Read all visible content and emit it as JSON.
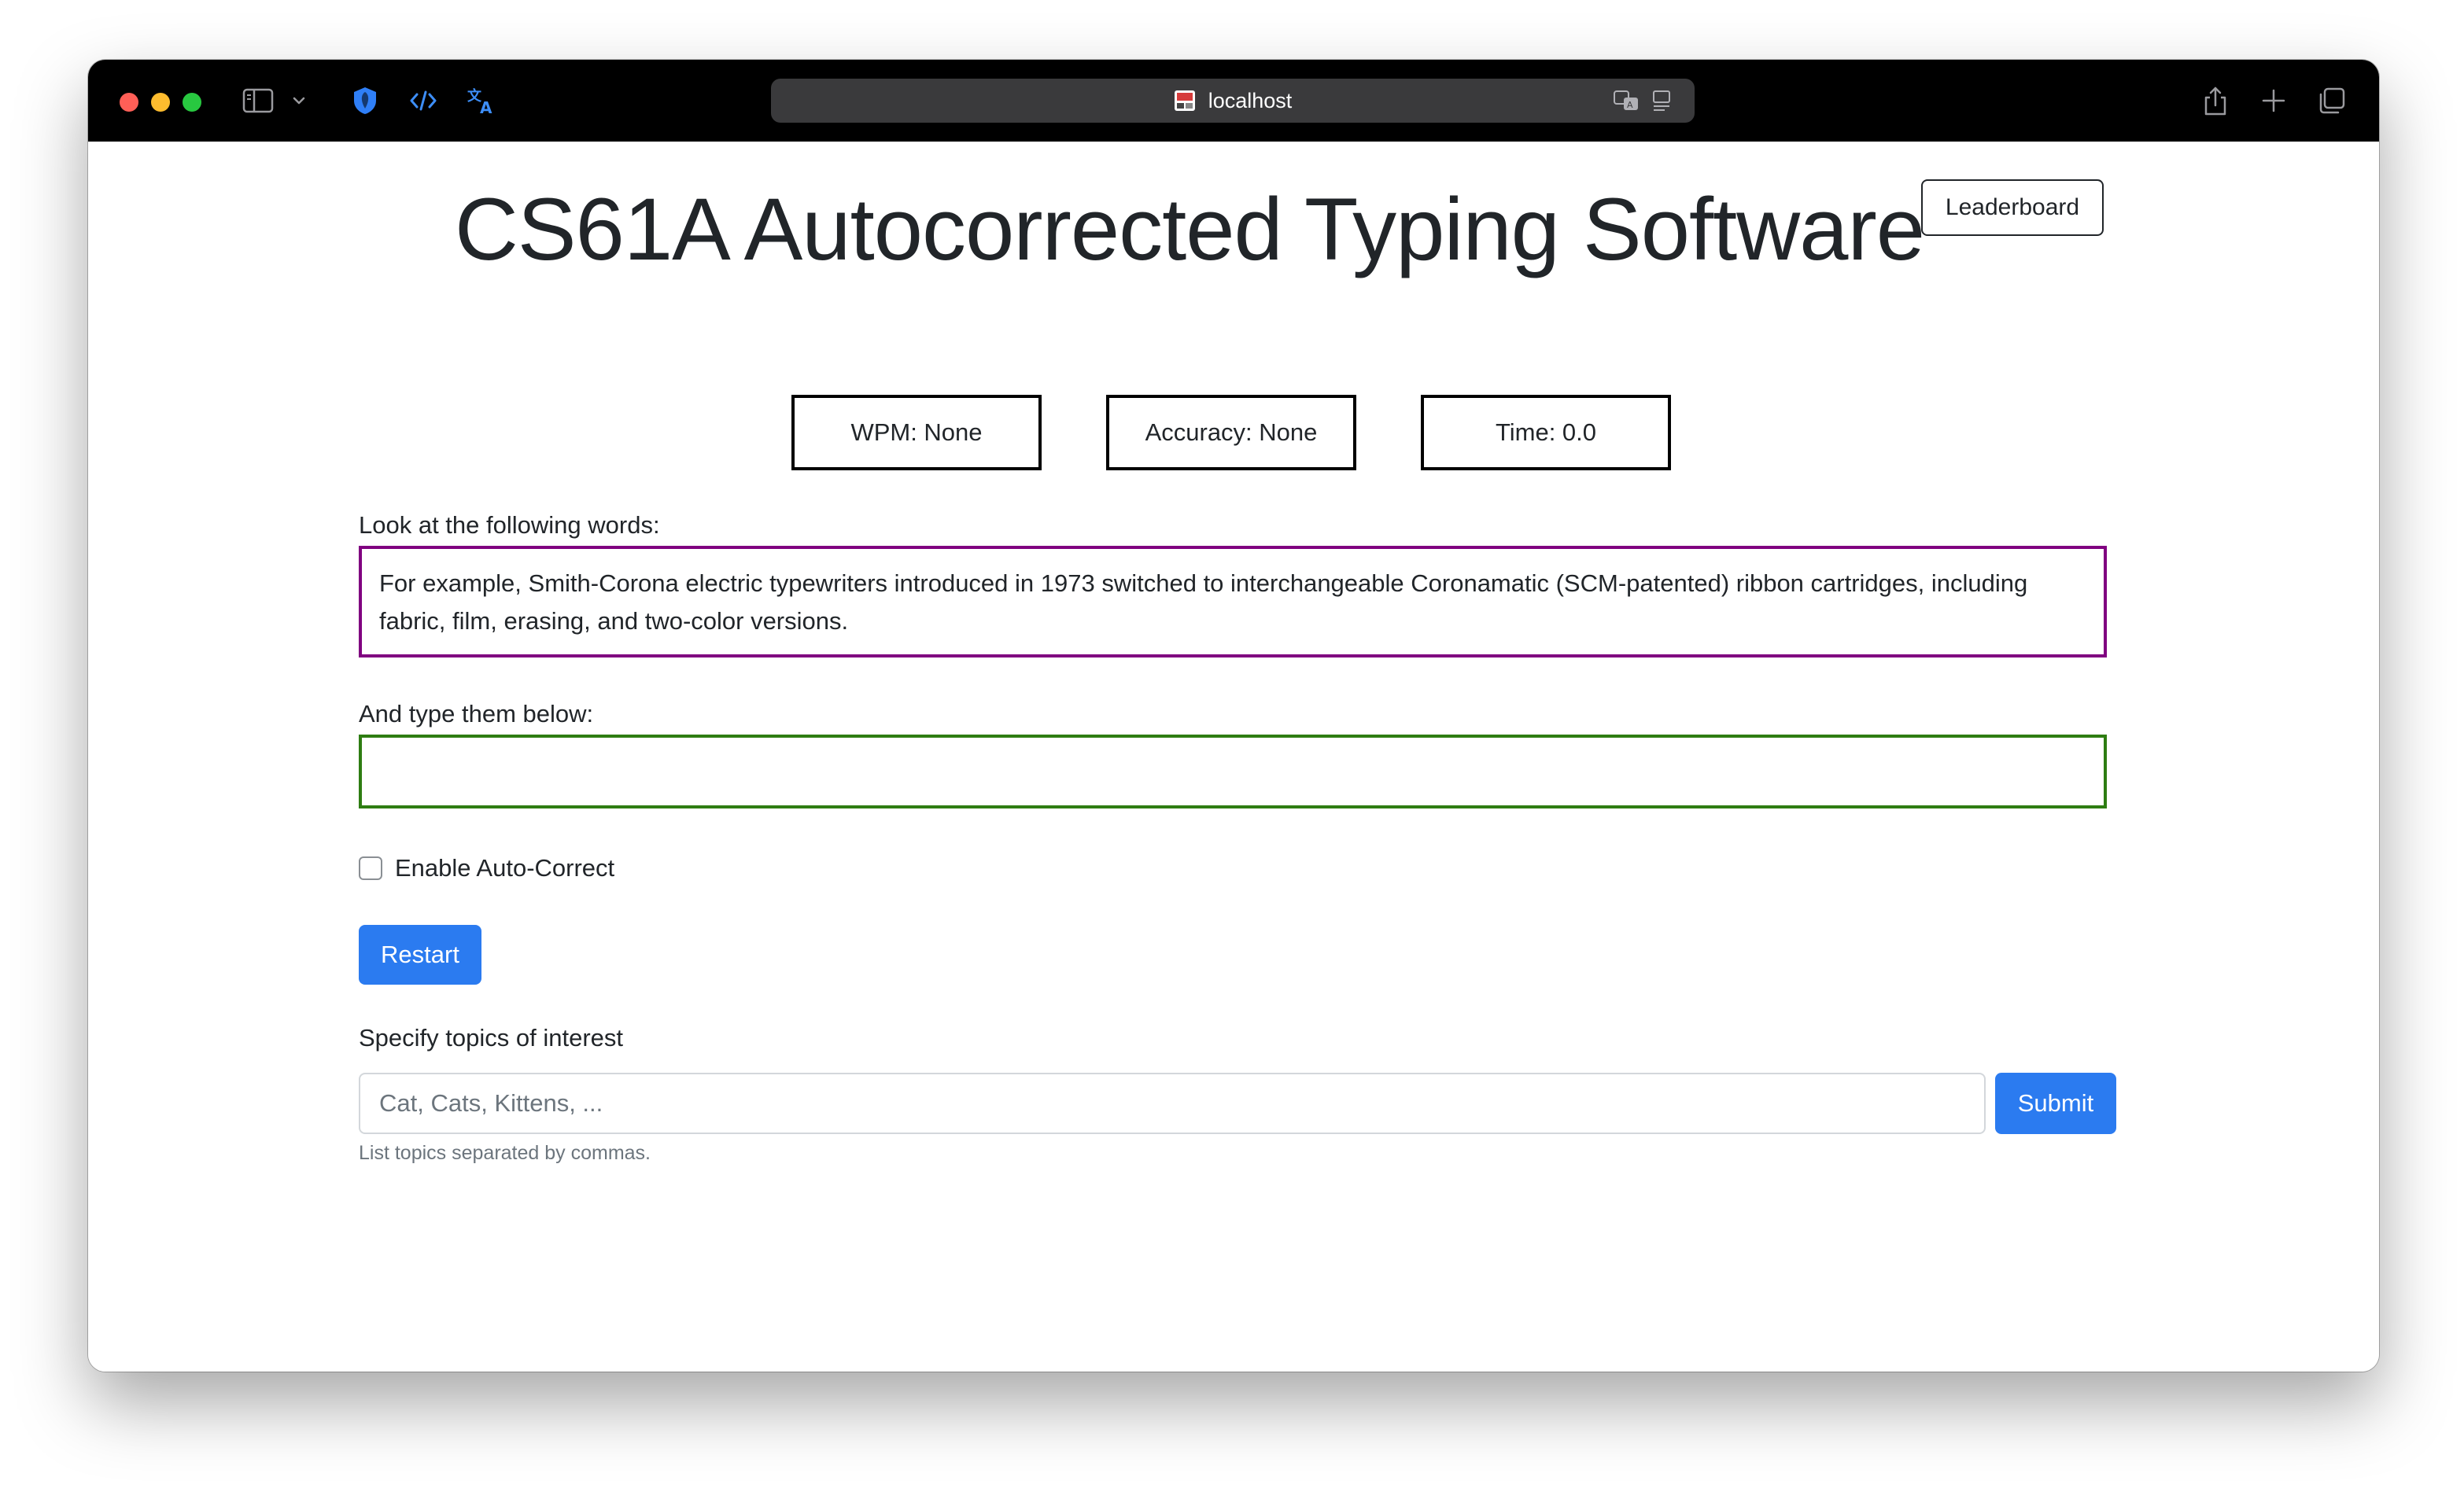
{
  "browser": {
    "address": "localhost",
    "icons": {
      "sidebar": "sidebar-icon",
      "chevron": "chevron-down-icon",
      "extension_1": "shield-extension-icon",
      "extension_2": "code-icon",
      "extension_3": "translate-icon",
      "translate_in_bar": "translate-icon",
      "reader": "reader-icon",
      "share": "share-icon",
      "new_tab": "plus-icon",
      "tabs": "tab-overview-icon"
    }
  },
  "page": {
    "title": "CS61A Autocorrected Typing Software",
    "leaderboard_label": "Leaderboard"
  },
  "stats": {
    "wpm": "WPM: None",
    "accuracy": "Accuracy: None",
    "time": "Time: 0.0"
  },
  "prompt": {
    "label": "Look at the following words:",
    "text": "For example, Smith-Corona electric typewriters introduced in 1973 switched to interchangeable Coronamatic (SCM-patented) ribbon cartridges, including fabric, film, erasing, and two-color versions."
  },
  "typing": {
    "label": "And type them below:",
    "value": ""
  },
  "autocorrect": {
    "label": "Enable Auto-Correct",
    "checked": false
  },
  "restart_label": "Restart",
  "topics": {
    "label": "Specify topics of interest",
    "placeholder": "Cat, Cats, Kittens, ...",
    "submit_label": "Submit",
    "help": "List topics separated by commas."
  },
  "colors": {
    "prompt_border": "#800080",
    "input_border": "#2e7d12",
    "primary_button": "#2b7bf0"
  }
}
